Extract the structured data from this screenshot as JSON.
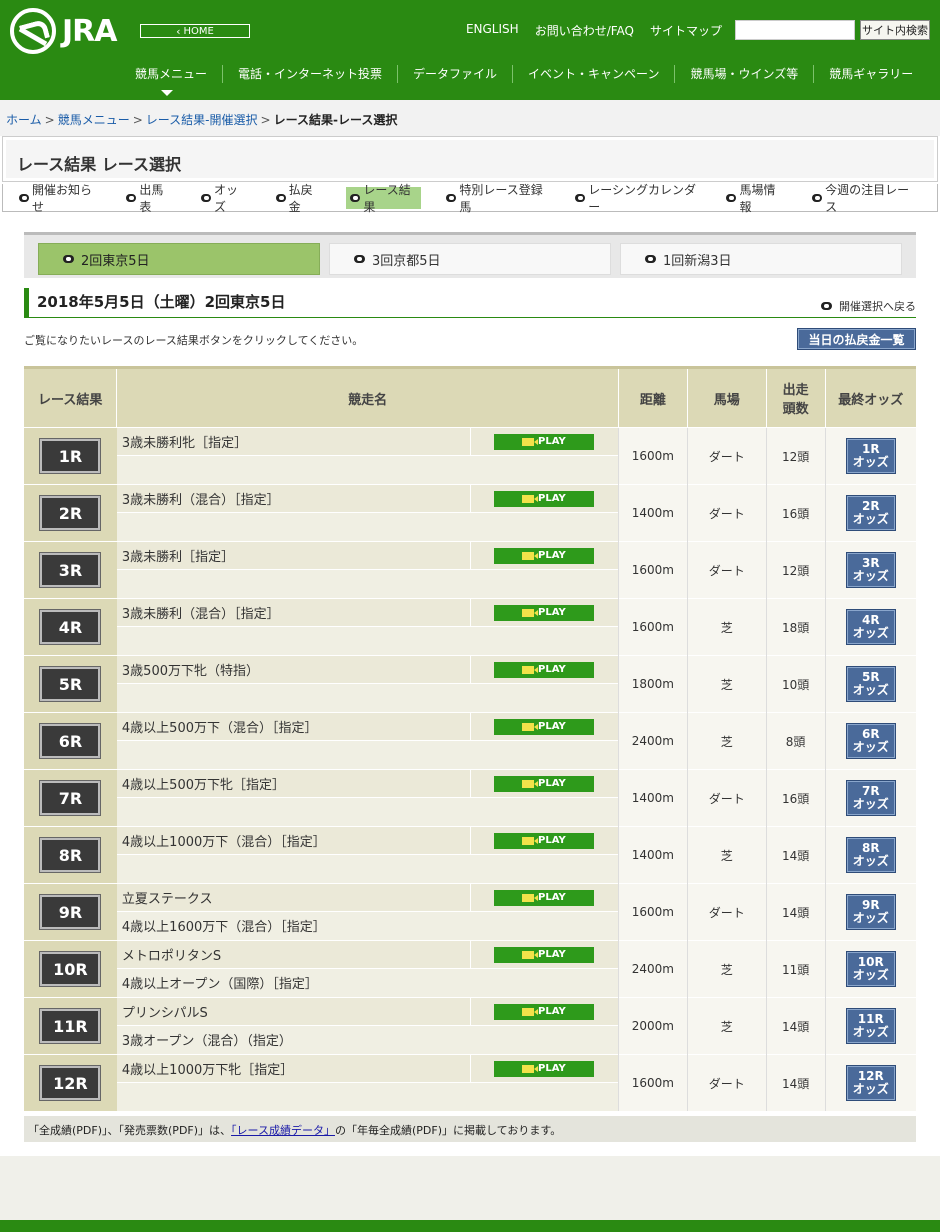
{
  "header": {
    "logo_text": "JRA",
    "home_label": "HOME",
    "top_links": [
      "ENGLISH",
      "お問い合わせ/FAQ",
      "サイトマップ"
    ],
    "search_button": "サイト内検索",
    "nav": [
      "競馬メニュー",
      "電話・インターネット投票",
      "データファイル",
      "イベント・キャンペーン",
      "競馬場・ウインズ等",
      "競馬ギャラリー"
    ]
  },
  "breadcrumb": {
    "items": [
      "ホーム",
      "競馬メニュー",
      "レース結果-開催選択"
    ],
    "current": "レース結果-レース選択",
    "separator": ">"
  },
  "page_title": "レース結果 レース選択",
  "subnav": [
    "開催お知らせ",
    "出馬表",
    "オッズ",
    "払戻金",
    "レース結果",
    "特別レース登録馬",
    "レーシングカレンダー",
    "馬場情報",
    "今週の注目レース"
  ],
  "meetings": [
    "2回東京5日",
    "3回京都5日",
    "1回新潟3日"
  ],
  "date_heading": "2018年5月5日（土曜）2回東京5日",
  "back_link": "開催選択へ戻る",
  "instruction": "ご覧になりたいレースのレース結果ボタンをクリックしてください。",
  "payout_button": "当日の払戻金一覧",
  "table": {
    "headers": {
      "result": "レース結果",
      "name": "競走名",
      "distance": "距離",
      "surface": "馬場",
      "count_1": "出走",
      "count_2": "頭数",
      "odds": "最終オッズ"
    },
    "play_label": "PLAY",
    "odds_suffix": "オッズ",
    "rows": [
      {
        "race": "1R",
        "name1": "3歳未勝利牝［指定］",
        "name2": "",
        "distance": "1600m",
        "surface": "ダート",
        "count": "12頭",
        "odds": "1R"
      },
      {
        "race": "2R",
        "name1": "3歳未勝利（混合）［指定］",
        "name2": "",
        "distance": "1400m",
        "surface": "ダート",
        "count": "16頭",
        "odds": "2R"
      },
      {
        "race": "3R",
        "name1": "3歳未勝利［指定］",
        "name2": "",
        "distance": "1600m",
        "surface": "ダート",
        "count": "12頭",
        "odds": "3R"
      },
      {
        "race": "4R",
        "name1": "3歳未勝利（混合）［指定］",
        "name2": "",
        "distance": "1600m",
        "surface": "芝",
        "count": "18頭",
        "odds": "4R"
      },
      {
        "race": "5R",
        "name1": "3歳500万下牝（特指）",
        "name2": "",
        "distance": "1800m",
        "surface": "芝",
        "count": "10頭",
        "odds": "5R"
      },
      {
        "race": "6R",
        "name1": "4歳以上500万下（混合）［指定］",
        "name2": "",
        "distance": "2400m",
        "surface": "芝",
        "count": "8頭",
        "odds": "6R"
      },
      {
        "race": "7R",
        "name1": "4歳以上500万下牝［指定］",
        "name2": "",
        "distance": "1400m",
        "surface": "ダート",
        "count": "16頭",
        "odds": "7R"
      },
      {
        "race": "8R",
        "name1": "4歳以上1000万下（混合）［指定］",
        "name2": "",
        "distance": "1400m",
        "surface": "芝",
        "count": "14頭",
        "odds": "8R"
      },
      {
        "race": "9R",
        "name1": "立夏ステークス",
        "name2": "4歳以上1600万下（混合）［指定］",
        "distance": "1600m",
        "surface": "ダート",
        "count": "14頭",
        "odds": "9R"
      },
      {
        "race": "10R",
        "name1": "メトロポリタンS",
        "name2": "4歳以上オープン（国際）［指定］",
        "distance": "2400m",
        "surface": "芝",
        "count": "11頭",
        "odds": "10R"
      },
      {
        "race": "11R",
        "name1": "プリンシパルS",
        "name2": "3歳オープン（混合）（指定）",
        "distance": "2000m",
        "surface": "芝",
        "count": "14頭",
        "odds": "11R"
      },
      {
        "race": "12R",
        "name1": "4歳以上1000万下牝［指定］",
        "name2": "",
        "distance": "1600m",
        "surface": "ダート",
        "count": "14頭",
        "odds": "12R"
      }
    ]
  },
  "footnote": {
    "before": "「全成績(PDF)」、「発売票数(PDF)」は、",
    "link": "「レース成績データ」",
    "after": "の「年毎全成績(PDF)」に掲載しております。"
  },
  "colors": {
    "brand_green": "#2a8a12",
    "active_tab": "#9bc46a",
    "odds_blue": "#4a6a9a",
    "play_green": "#2e9a1b"
  }
}
